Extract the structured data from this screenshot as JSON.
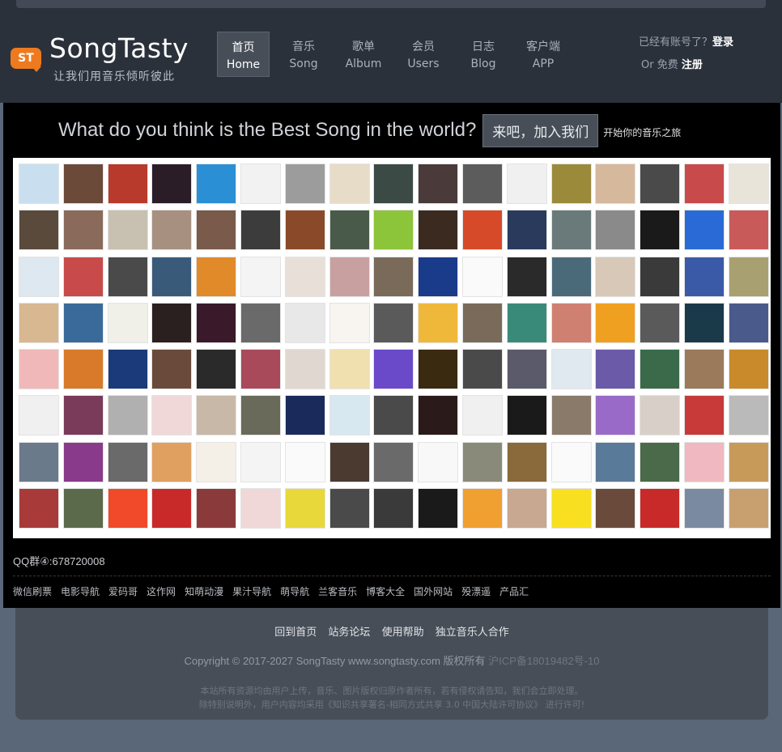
{
  "header": {
    "logo_badge": "ST",
    "brand": "SongTasty",
    "slogan": "让我们用音乐倾听彼此",
    "nav": [
      {
        "cn": "首页",
        "en": "Home",
        "active": true
      },
      {
        "cn": "音乐",
        "en": "Song"
      },
      {
        "cn": "歌单",
        "en": "Album"
      },
      {
        "cn": "会员",
        "en": "Users"
      },
      {
        "cn": "日志",
        "en": "Blog"
      },
      {
        "cn": "客户端",
        "en": "APP"
      }
    ],
    "auth": {
      "has_account": "已经有账号了？",
      "login": "登录",
      "or_free": "Or 免费",
      "register": "注册"
    }
  },
  "hero": {
    "question": "What do you think is the Best Song in the world?",
    "join_button": "来吧，加入我们",
    "tip": "开始你的音乐之旅"
  },
  "avatar_colors": [
    "#c9dff0",
    "#6b4a3a",
    "#b83a2c",
    "#2a1d28",
    "#2b8fd6",
    "#f2f2f2",
    "#9c9c9c",
    "#e6dcc8",
    "#3b4a44",
    "#4a3a3a",
    "#5c5c5c",
    "#f0f0f0",
    "#9a8a3a",
    "#d6b89c",
    "#4a4a4a",
    "#c94a4a",
    "#e8e4da",
    "#5a4a3c",
    "#8a6a5a",
    "#c8c0b0",
    "#a89080",
    "#7a5a4a",
    "#3c3c3c",
    "#8a4a2a",
    "#4a5a4a",
    "#8cc43a",
    "#3a2a20",
    "#d64a2a",
    "#2a3a5c",
    "#6a7a7a",
    "#8a8a8a",
    "#1a1a1a",
    "#2a6ad6",
    "#c85a5a",
    "#dde8f0",
    "#c84a4a",
    "#4a4a4a",
    "#3a5a7a",
    "#e08a2a",
    "#f4f4f4",
    "#e8e0d8",
    "#c8a0a0",
    "#7a6a5a",
    "#1a3a8a",
    "#fafafa",
    "#2a2a2a",
    "#4a6a7a",
    "#d8c8b8",
    "#3a3a3a",
    "#3a5aa8",
    "#a8a070",
    "#d8b890",
    "#3a6a9a",
    "#f0f0e8",
    "#2a2020",
    "#3a1a2a",
    "#6a6a6a",
    "#e8e8e8",
    "#f8f4f0",
    "#5a5a5a",
    "#f0b83a",
    "#7a6a5a",
    "#3a8a7a",
    "#d08070",
    "#f0a020",
    "#5a5a5a",
    "#1a3a4a",
    "#4a5a8a",
    "#f0b8b8",
    "#d87a2a",
    "#1a3a7a",
    "#6a4a3a",
    "#2a2a2a",
    "#a84a5a",
    "#e0d8d0",
    "#f0e0b0",
    "#6a4ac8",
    "#3a2a10",
    "#4a4a4a",
    "#5a5a6a",
    "#e0e8f0",
    "#6a5aa8",
    "#3a6a4a",
    "#9a7a5a",
    "#c88a2a",
    "#f0f0f0",
    "#7a3a5a",
    "#b0b0b0",
    "#f0d8d8",
    "#c8b8a8",
    "#6a6a5a",
    "#1a2a5a",
    "#d8e8f0",
    "#4a4a4a",
    "#2a1a1a",
    "#f0f0f0",
    "#1a1a1a",
    "#8a7a6a",
    "#9a6ac8",
    "#d8d0c8",
    "#c83a3a",
    "#bababa",
    "#6a7a8a",
    "#8a3a8a",
    "#6a6a6a",
    "#e0a060",
    "#f4f0e8",
    "#f4f4f4",
    "#fafafa",
    "#4a3a30",
    "#6a6a6a",
    "#f8f8f8",
    "#8a8a7a",
    "#8a6a3a",
    "#fafafa",
    "#5a7a9a",
    "#4a6a4a",
    "#f0b8c0",
    "#c89a5a",
    "#a83a3a",
    "#5a6a4a",
    "#f04a2a",
    "#c82a2a",
    "#8a3a3a",
    "#f0d8d8",
    "#e8d83a",
    "#4a4a4a",
    "#3a3a3a",
    "#1a1a1a",
    "#f0a030",
    "#c8a890",
    "#f8e020",
    "#6a4a3a",
    "#c82a2a",
    "#7a8aa0",
    "#c8a070"
  ],
  "qq": "QQ群④:678720008",
  "friend_links": [
    "微信刷票",
    "电影导航",
    "爱码哥",
    "这作网",
    "知萌动漫",
    "果汁导航",
    "萌导航",
    "兰客音乐",
    "博客大全",
    "国外网站",
    "殁漂遥",
    "产品汇"
  ],
  "footer": {
    "links": [
      "回到首页",
      "站务论坛",
      "使用帮助",
      "独立音乐人合作"
    ],
    "copyright": "Copyright © 2017-2027 SongTasty www.songtasty.com 版权所有 ",
    "icp": "沪ICP备18019482号-10",
    "notice_1": "本站所有资源均由用户上传，音乐、图片版权归原作者所有，若有侵权请告知，我们会立即处理。",
    "notice_2": "除特别说明外，用户内容均采用《知识共享署名-相同方式共享 3.0 中国大陆许可协议》 进行许可!"
  }
}
